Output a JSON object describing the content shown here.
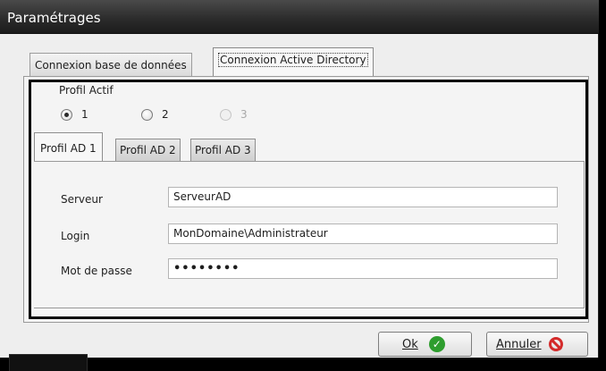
{
  "window": {
    "title": "Paramétrages"
  },
  "outer_tabs": [
    {
      "label": "Connexion base de données",
      "active": false
    },
    {
      "label": "Connexion Active Directory",
      "active": true
    }
  ],
  "profil": {
    "label": "Profil Actif",
    "options": [
      {
        "label": "1",
        "checked": true,
        "disabled": false
      },
      {
        "label": "2",
        "checked": false,
        "disabled": false
      },
      {
        "label": "3",
        "checked": false,
        "disabled": true
      }
    ]
  },
  "inner_tabs": [
    {
      "label": "Profil AD 1",
      "active": true
    },
    {
      "label": "Profil AD 2",
      "active": false
    },
    {
      "label": "Profil AD 3",
      "active": false
    }
  ],
  "fields": {
    "serveur": {
      "label": "Serveur",
      "value": "ServeurAD"
    },
    "login": {
      "label": "Login",
      "value": "MonDomaine\\Administrateur"
    },
    "password": {
      "label": "Mot de passe",
      "value": "••••••••"
    }
  },
  "buttons": {
    "ok": {
      "label": "Ok",
      "icon": "check-circle-icon"
    },
    "cancel": {
      "label": "Annuler",
      "icon": "prohibited-icon"
    }
  },
  "colors": {
    "ok_icon": "#2e9d2e",
    "cancel_icon": "#d42b2b",
    "titlebar": "#2a2a2a"
  }
}
